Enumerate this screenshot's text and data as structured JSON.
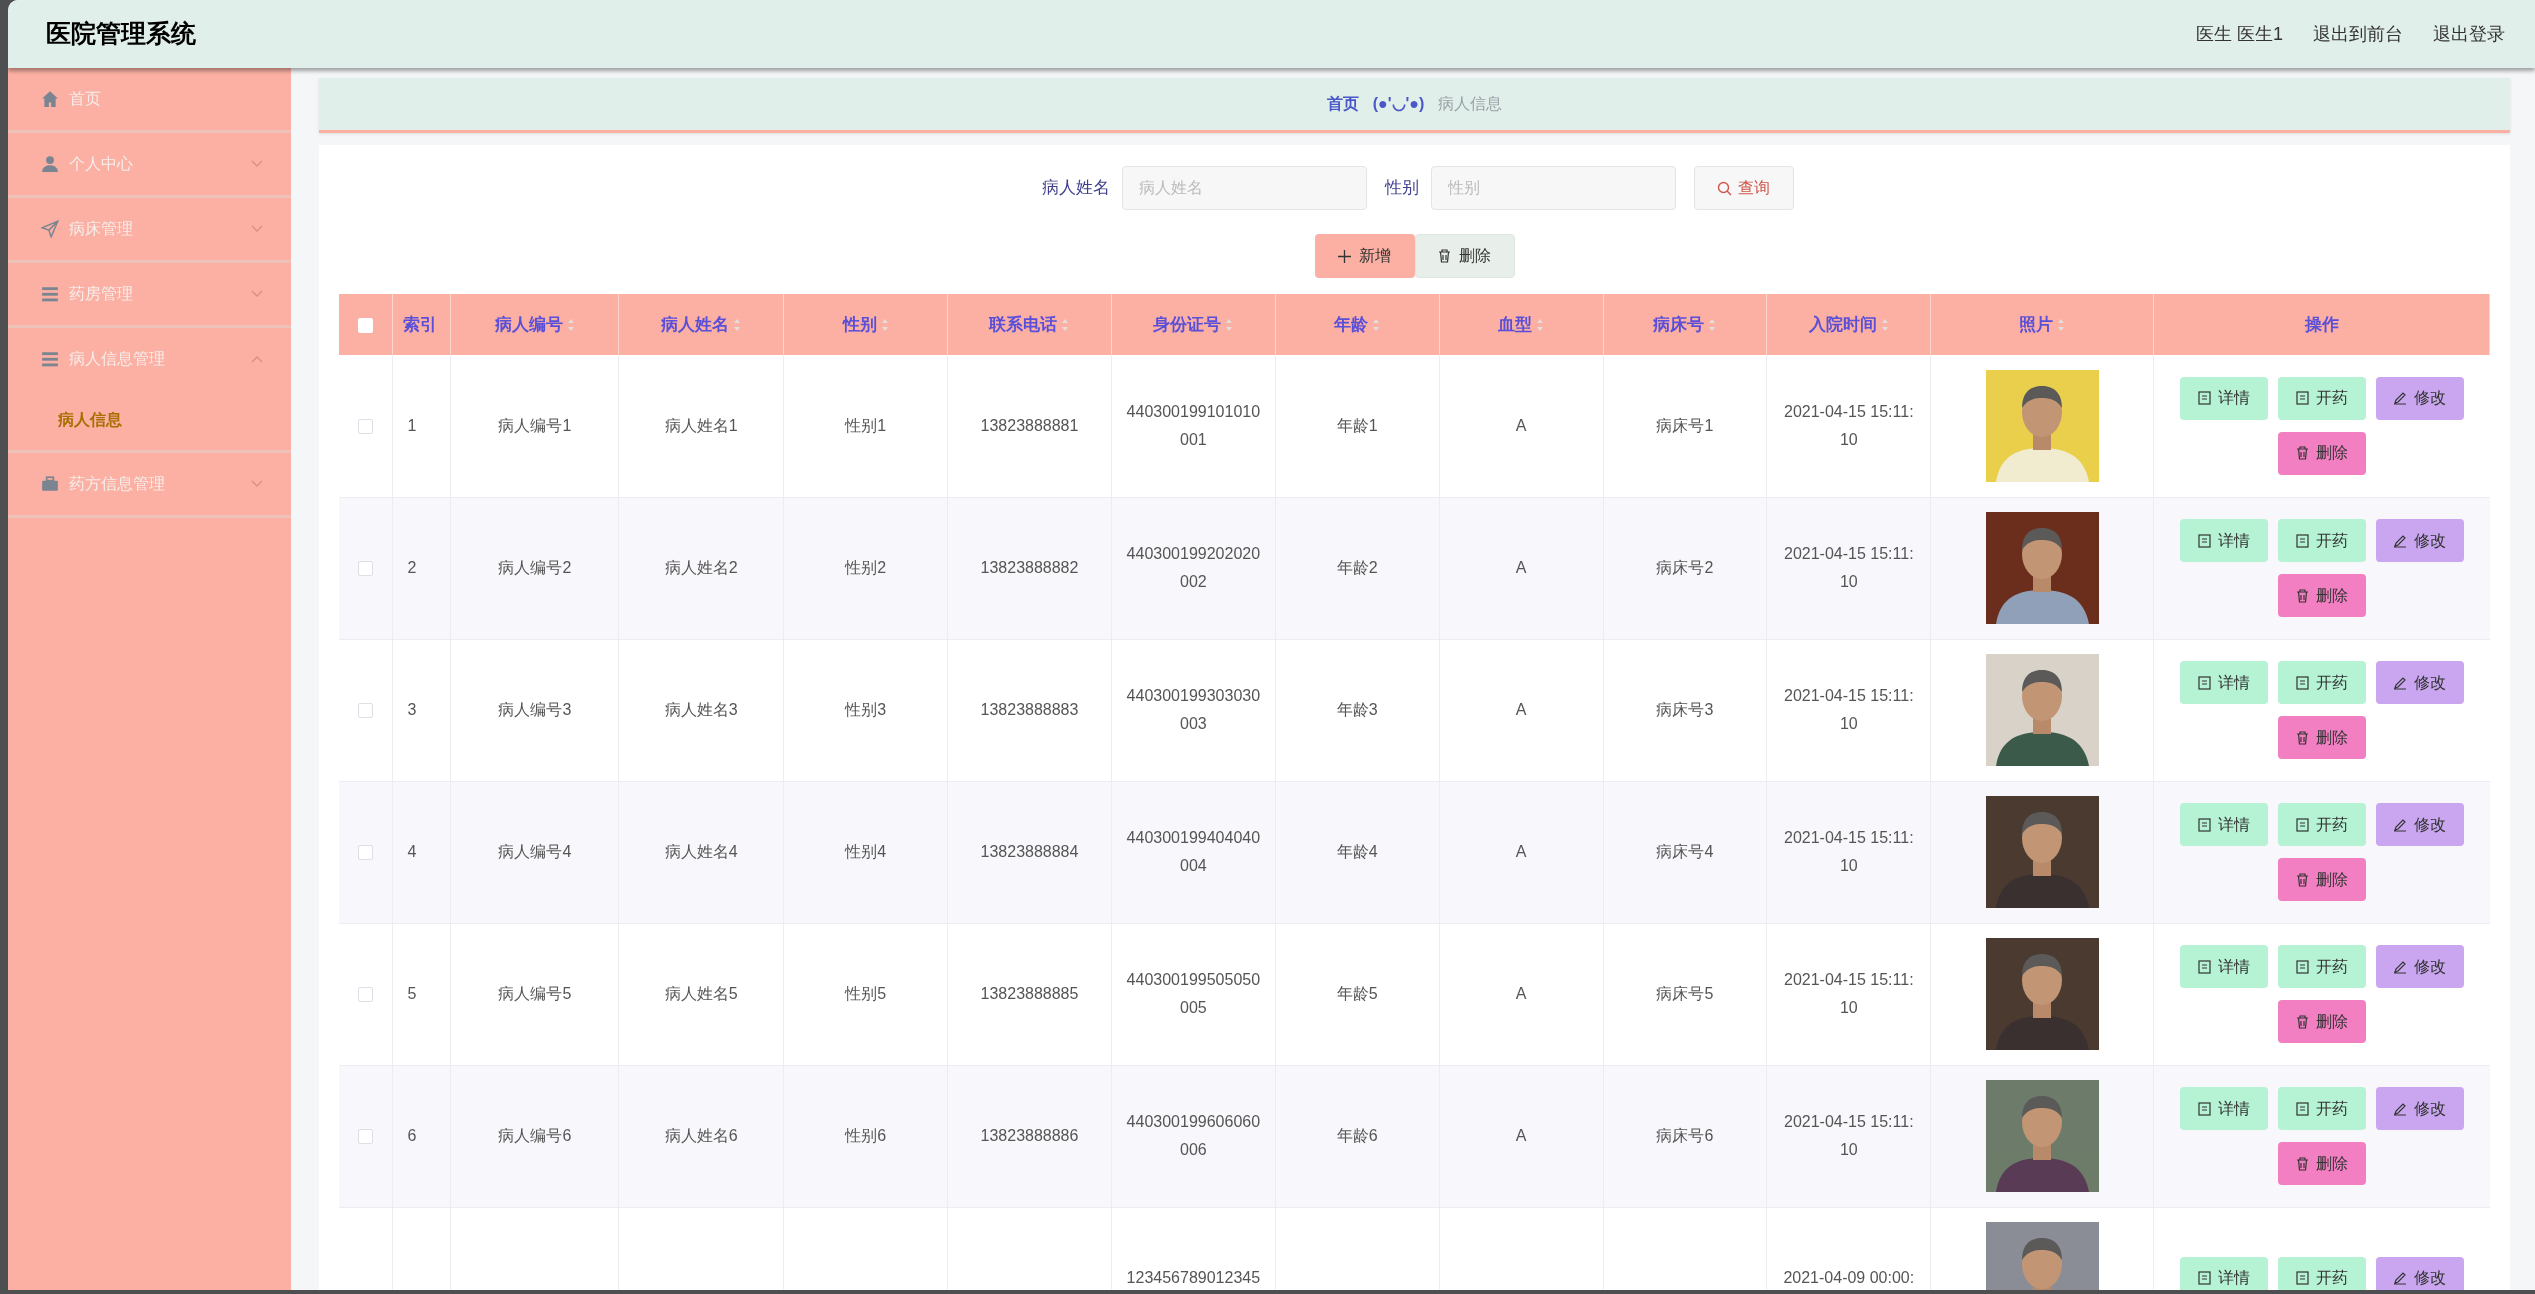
{
  "header": {
    "title": "医院管理系统",
    "user": "医生 医生1",
    "links": [
      "退出到前台",
      "退出登录"
    ]
  },
  "sidebar": {
    "items": [
      {
        "label": "首页"
      },
      {
        "label": "个人中心",
        "expanded": false
      },
      {
        "label": "病床管理",
        "expanded": false
      },
      {
        "label": "药房管理",
        "expanded": false
      },
      {
        "label": "病人信息管理",
        "expanded": true,
        "children": [
          {
            "label": "病人信息",
            "selected": true
          }
        ]
      },
      {
        "label": "药方信息管理",
        "expanded": false
      }
    ]
  },
  "breadcrumb": {
    "home": "首页",
    "separator": "(●'◡'●)",
    "current": "病人信息"
  },
  "search": {
    "fields": [
      {
        "label": "病人姓名",
        "placeholder": "病人姓名"
      },
      {
        "label": "性别",
        "placeholder": "性别"
      }
    ],
    "button": "查询"
  },
  "actions": [
    "新增",
    "删除"
  ],
  "table": {
    "select_all": false,
    "columns": [
      {
        "label": "索引",
        "sortable": false
      },
      {
        "label": "病人编号",
        "sortable": true
      },
      {
        "label": "病人姓名",
        "sortable": true
      },
      {
        "label": "性别",
        "sortable": true
      },
      {
        "label": "联系电话",
        "sortable": true
      },
      {
        "label": "身份证号",
        "sortable": true
      },
      {
        "label": "年龄",
        "sortable": true
      },
      {
        "label": "血型",
        "sortable": true
      },
      {
        "label": "病床号",
        "sortable": true
      },
      {
        "label": "入院时间",
        "sortable": true
      },
      {
        "label": "照片",
        "sortable": true
      },
      {
        "label": "操作",
        "sortable": false
      }
    ],
    "rows": [
      {
        "checked": false,
        "cells": [
          "1",
          "病人编号1",
          "病人姓名1",
          "性别1",
          "13823888881",
          "440300199101010001",
          "年龄1",
          "A",
          "病床号1",
          "2021-04-15 15:11:10"
        ],
        "photo": {
          "kind": "picture"
        },
        "actions": [
          "详情",
          "开药",
          "修改",
          "删除"
        ]
      },
      {
        "checked": false,
        "cells": [
          "2",
          "病人编号2",
          "病人姓名2",
          "性别2",
          "13823888882",
          "440300199202020002",
          "年龄2",
          "A",
          "病床号2",
          "2021-04-15 15:11:10"
        ],
        "photo": {
          "kind": "picture"
        },
        "actions": [
          "详情",
          "开药",
          "修改",
          "删除"
        ]
      },
      {
        "checked": false,
        "cells": [
          "3",
          "病人编号3",
          "病人姓名3",
          "性别3",
          "13823888883",
          "440300199303030003",
          "年龄3",
          "A",
          "病床号3",
          "2021-04-15 15:11:10"
        ],
        "photo": {
          "kind": "picture"
        },
        "actions": [
          "详情",
          "开药",
          "修改",
          "删除"
        ]
      },
      {
        "checked": false,
        "cells": [
          "4",
          "病人编号4",
          "病人姓名4",
          "性别4",
          "13823888884",
          "440300199404040004",
          "年龄4",
          "A",
          "病床号4",
          "2021-04-15 15:11:10"
        ],
        "photo": {
          "kind": "picture"
        },
        "actions": [
          "详情",
          "开药",
          "修改",
          "删除"
        ]
      },
      {
        "checked": false,
        "cells": [
          "5",
          "病人编号5",
          "病人姓名5",
          "性别5",
          "13823888885",
          "440300199505050005",
          "年龄5",
          "A",
          "病床号5",
          "2021-04-15 15:11:10"
        ],
        "photo": {
          "kind": "picture"
        },
        "actions": [
          "详情",
          "开药",
          "修改",
          "删除"
        ]
      },
      {
        "checked": false,
        "cells": [
          "6",
          "病人编号6",
          "病人姓名6",
          "性别6",
          "13823888886",
          "440300199606060006",
          "年龄6",
          "A",
          "病床号6",
          "2021-04-15 15:11:10"
        ],
        "photo": {
          "kind": "picture"
        },
        "actions": [
          "详情",
          "开药",
          "修改",
          "删除"
        ]
      },
      {
        "cells": [
          null,
          null,
          null,
          null,
          null,
          "123456789012345",
          null,
          null,
          null,
          "2021-04-09 00:00:"
        ],
        "photo": {
          "kind": "picture"
        },
        "actions": [
          "详情",
          "开药",
          "修改"
        ]
      }
    ]
  }
}
